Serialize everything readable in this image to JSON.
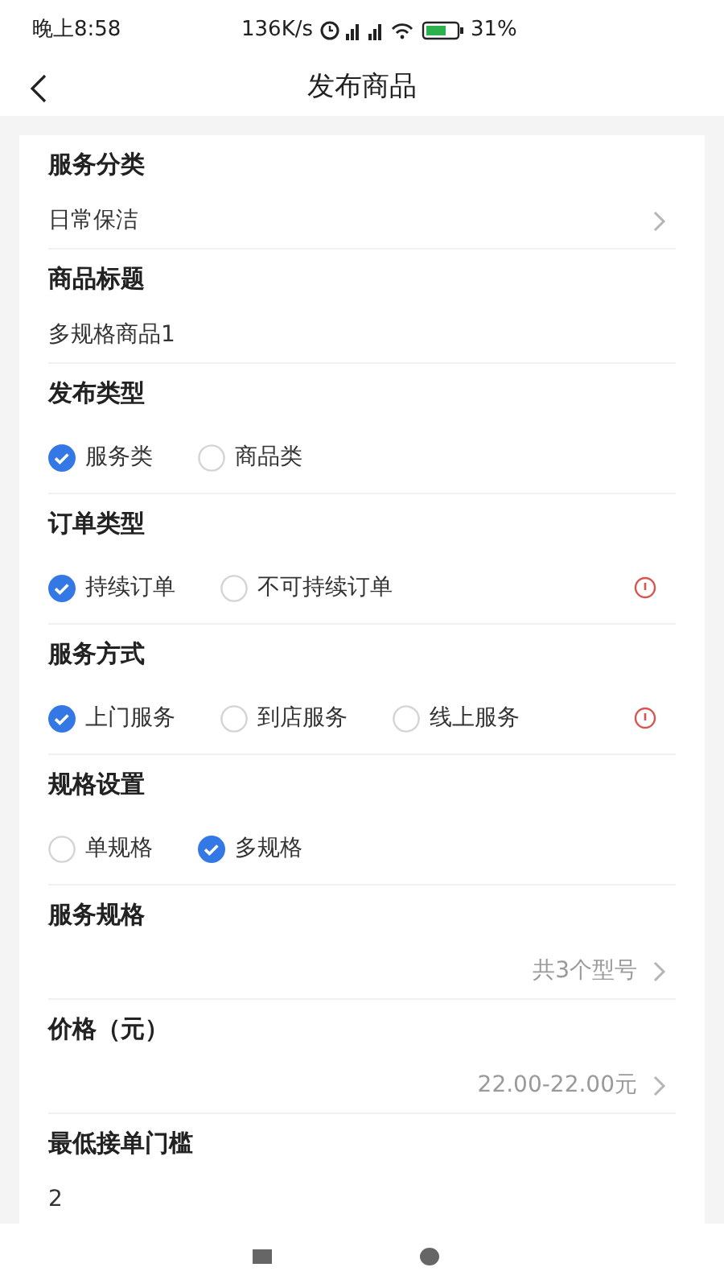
{
  "status_bar": {
    "time": "晚上8:58",
    "speed": "136K/s",
    "battery": "31%"
  },
  "header": {
    "title": "发布商品"
  },
  "sections": [
    {
      "kind": "select",
      "title": "服务分类",
      "value": "日常保洁"
    },
    {
      "kind": "input",
      "title": "商品标题",
      "value": "多规格商品1"
    },
    {
      "kind": "choice",
      "title": "发布类型",
      "info": false,
      "options": [
        {
          "label": "服务类",
          "selected": true
        },
        {
          "label": "商品类",
          "selected": false
        }
      ]
    },
    {
      "kind": "choice",
      "title": "订单类型",
      "info": true,
      "options": [
        {
          "label": "持续订单",
          "selected": true
        },
        {
          "label": "不可持续订单",
          "selected": false
        }
      ]
    },
    {
      "kind": "choice",
      "title": "服务方式",
      "info": true,
      "options": [
        {
          "label": "上门服务",
          "selected": true
        },
        {
          "label": "到店服务",
          "selected": false
        },
        {
          "label": "线上服务",
          "selected": false
        }
      ]
    },
    {
      "kind": "choice",
      "title": "规格设置",
      "info": false,
      "options": [
        {
          "label": "单规格",
          "selected": false
        },
        {
          "label": "多规格",
          "selected": true
        }
      ]
    },
    {
      "kind": "link",
      "title": "服务规格",
      "value": "共3个型号"
    },
    {
      "kind": "link",
      "title": "价格（元）",
      "value": "22.00-22.00元"
    },
    {
      "kind": "input",
      "title": "最低接单门槛",
      "value": "2"
    }
  ]
}
